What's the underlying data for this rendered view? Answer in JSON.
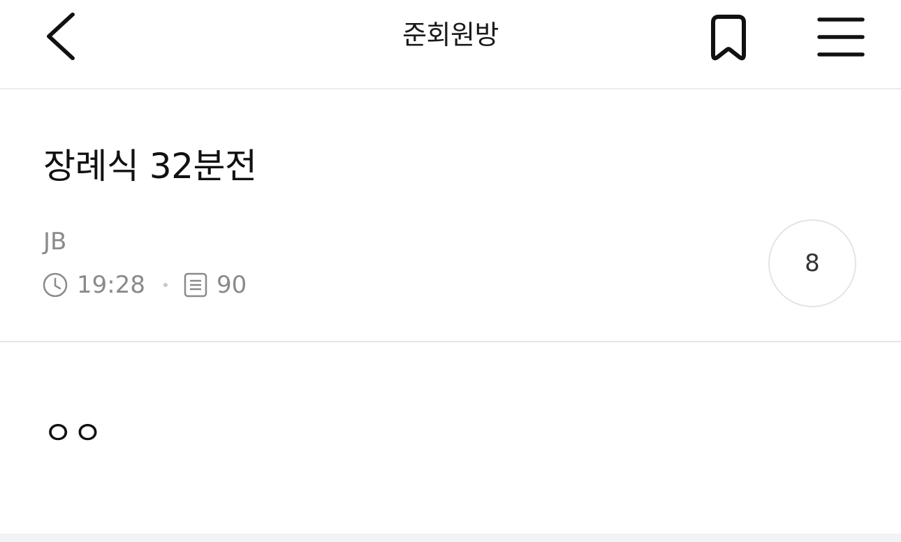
{
  "header": {
    "title": "준회원방",
    "back_icon": "chevron-left-icon",
    "bookmark_icon": "bookmark-icon",
    "menu_icon": "hamburger-menu-icon"
  },
  "post": {
    "title": "장례식 32분전",
    "author": "JB",
    "time": "19:28",
    "views": "90",
    "comment_count": "8",
    "body": "ㅇㅇ"
  },
  "colors": {
    "text_primary": "#111111",
    "text_secondary": "#8a8a8a",
    "divider": "#ececec",
    "bottom_strip": "#f2f3f5"
  }
}
